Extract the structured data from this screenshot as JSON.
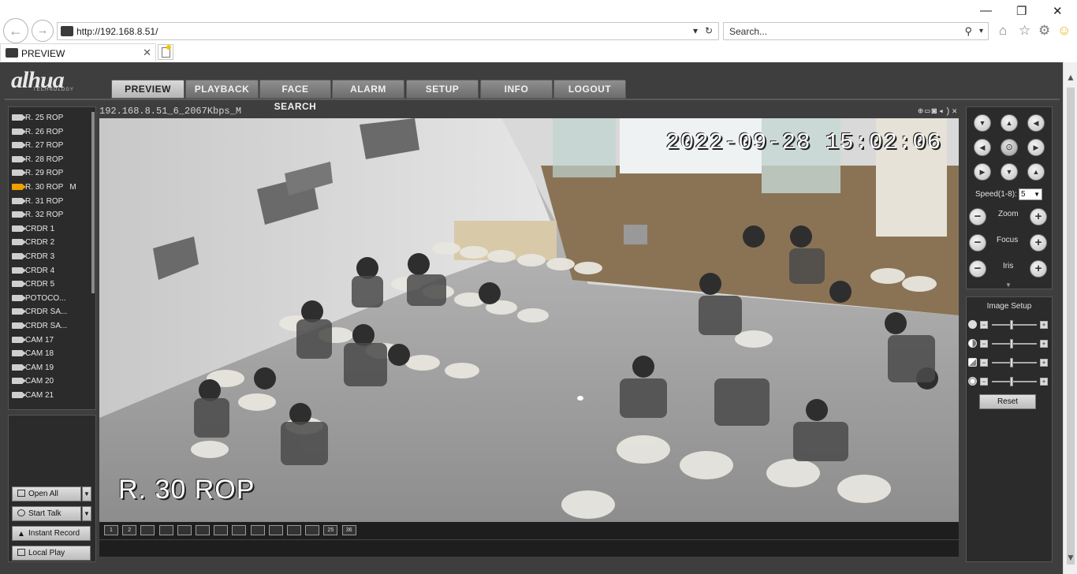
{
  "browser": {
    "url": "http://192.168.8.51/",
    "search_placeholder": "Search...",
    "tab_title": "PREVIEW"
  },
  "nav": {
    "items": [
      "PREVIEW",
      "PLAYBACK",
      "FACE SEARCH",
      "ALARM",
      "SETUP",
      "INFO",
      "LOGOUT"
    ],
    "active": "PREVIEW"
  },
  "brand": {
    "logo": "alhua",
    "tagline": "TECHNOLOGY"
  },
  "cameras": [
    {
      "label": "R. 25 ROP"
    },
    {
      "label": "R. 26 ROP"
    },
    {
      "label": "R. 27 ROP"
    },
    {
      "label": "R. 28 ROP"
    },
    {
      "label": "R. 29 ROP"
    },
    {
      "label": "R. 30 ROP",
      "flag": "M",
      "active": true
    },
    {
      "label": "R. 31 ROP"
    },
    {
      "label": "R. 32 ROP"
    },
    {
      "label": "CRDR 1"
    },
    {
      "label": "CRDR 2"
    },
    {
      "label": "CRDR 3"
    },
    {
      "label": "CRDR 4"
    },
    {
      "label": "CRDR 5"
    },
    {
      "label": "POTOCO..."
    },
    {
      "label": "CRDR SA..."
    },
    {
      "label": "CRDR SA..."
    },
    {
      "label": "CAM 17"
    },
    {
      "label": "CAM 18"
    },
    {
      "label": "CAM 19"
    },
    {
      "label": "CAM 20"
    },
    {
      "label": "CAM 21"
    }
  ],
  "actions": {
    "open_all": "Open All",
    "start_talk": "Start Talk",
    "instant_record": "Instant Record",
    "local_play": "Local Play"
  },
  "video": {
    "stream_info": "192.168.8.51_6_2067Kbps_M",
    "timestamp": "2022-09-28 15:02:06",
    "camera_name": "R. 30 ROP"
  },
  "layouts": [
    "1",
    "2",
    "",
    "",
    "",
    "",
    "",
    "",
    "",
    "",
    "",
    "",
    "25",
    "36"
  ],
  "ptz": {
    "speed_label": "Speed(1-8):",
    "speed_value": "5",
    "zoom_label": "Zoom",
    "focus_label": "Focus",
    "iris_label": "Iris"
  },
  "image_setup": {
    "title": "Image Setup",
    "reset_label": "Reset"
  },
  "colors": {
    "app_bg": "#3e3e3e",
    "panel_bg": "#2b2b2b",
    "active_camera_icon": "#f0a000"
  }
}
